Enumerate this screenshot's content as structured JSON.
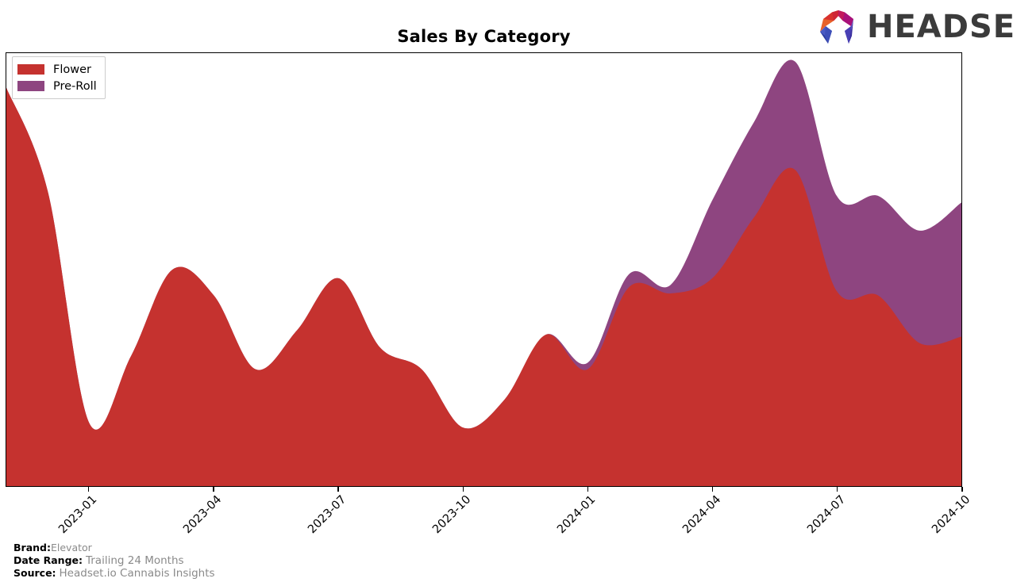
{
  "title": "Sales By Category",
  "logo": {
    "wordmark": "HEADSET",
    "mark_name": "headset-hexagon-logo"
  },
  "legend": {
    "position": "upper-left",
    "items": [
      {
        "label": "Flower",
        "color": "#C5322F"
      },
      {
        "label": "Pre-Roll",
        "color": "#8E4580"
      }
    ]
  },
  "footer": {
    "brand_key": "Brand:",
    "brand_value": "Elevator",
    "date_key": "Date Range:",
    "date_value": "Trailing 24 Months",
    "source_key": "Source:",
    "source_value": "Headset.io Cannabis Insights"
  },
  "chart_data": {
    "type": "area",
    "stacked": true,
    "title": "Sales By Category",
    "xlabel": "",
    "ylabel": "",
    "grid": false,
    "legend_position": "upper left",
    "axis_tick_labels": [
      "2023-01",
      "2023-04",
      "2023-07",
      "2023-10",
      "2024-01",
      "2024-04",
      "2024-07",
      "2024-10"
    ],
    "x": [
      "2022-11",
      "2022-12",
      "2023-01",
      "2023-02",
      "2023-03",
      "2023-04",
      "2023-05",
      "2023-06",
      "2023-07",
      "2023-08",
      "2023-09",
      "2023-10",
      "2023-11",
      "2023-12",
      "2024-01",
      "2024-02",
      "2024-03",
      "2024-04",
      "2024-05",
      "2024-06",
      "2024-07",
      "2024-08",
      "2024-09",
      "2024-10"
    ],
    "ylim": [
      0,
      100
    ],
    "series": [
      {
        "name": "Flower",
        "color": "#C5322F",
        "values": [
          92.0,
          68.0,
          14.5,
          30.0,
          50.0,
          44.0,
          27.0,
          36.0,
          48.0,
          32.0,
          27.0,
          13.5,
          20.0,
          35.0,
          27.0,
          46.0,
          44.5,
          48.0,
          62.0,
          73.0,
          45.0,
          44.0,
          33.0,
          34.5
        ]
      },
      {
        "name": "Pre-Roll",
        "color": "#8E4580",
        "values": [
          0.0,
          0.0,
          0.0,
          0.0,
          0.0,
          0.0,
          0.0,
          0.0,
          0.0,
          0.0,
          0.0,
          0.0,
          0.0,
          0.0,
          1.5,
          3.0,
          2.0,
          18.0,
          22.0,
          25.0,
          22.0,
          23.0,
          26.0,
          31.0
        ]
      }
    ],
    "totals": [
      92.0,
      68.0,
      14.5,
      30.0,
      50.0,
      44.0,
      27.0,
      36.0,
      48.0,
      32.0,
      27.0,
      13.5,
      20.0,
      35.0,
      28.5,
      49.0,
      46.5,
      66.0,
      84.0,
      98.0,
      67.0,
      67.0,
      59.0,
      65.5
    ]
  }
}
